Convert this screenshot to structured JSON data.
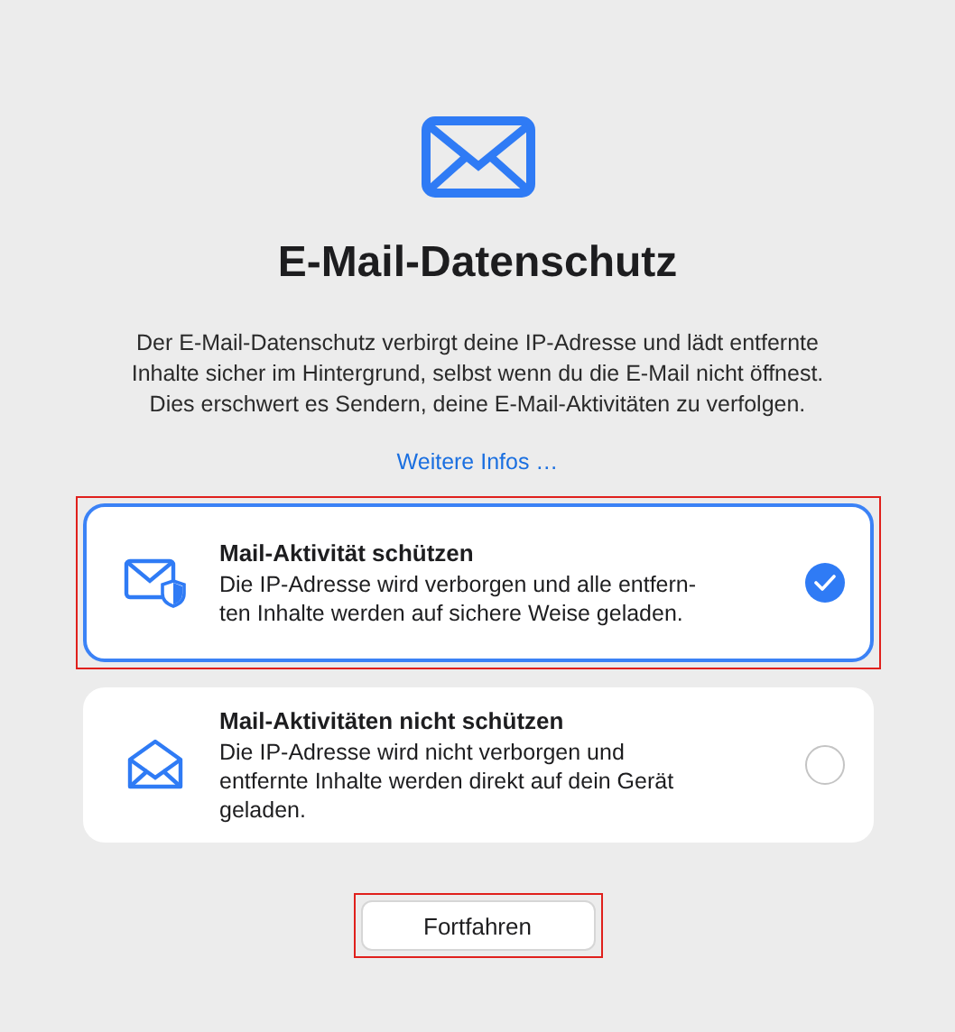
{
  "title": "E-Mail-Datenschutz",
  "intro": "Der E-Mail-Datenschutz verbirgt deine IP-Adresse und lädt entfernte\nInhalte sicher im Hintergrund, selbst wenn du die E-Mail nicht öffnest.\nDies erschwert es Sendern, deine E-Mail-Aktivitäten zu verfolgen.",
  "link": "Weitere Infos …",
  "options": [
    {
      "kind": "protect",
      "title": "Mail-Aktivität schützen",
      "description": "Die IP-Adresse wird verborgen und alle entfern-\nten Inhalte werden auf sichere Weise geladen.",
      "selected": true,
      "highlighted": true
    },
    {
      "kind": "open",
      "title": "Mail-Aktivitäten nicht schützen",
      "description": "Die IP-Adresse wird nicht verborgen und\nentfernte Inhalte werden direkt auf dein Gerät\ngeladen.",
      "selected": false,
      "highlighted": false
    }
  ],
  "button": {
    "label": "Fortfahren",
    "highlighted": true
  }
}
